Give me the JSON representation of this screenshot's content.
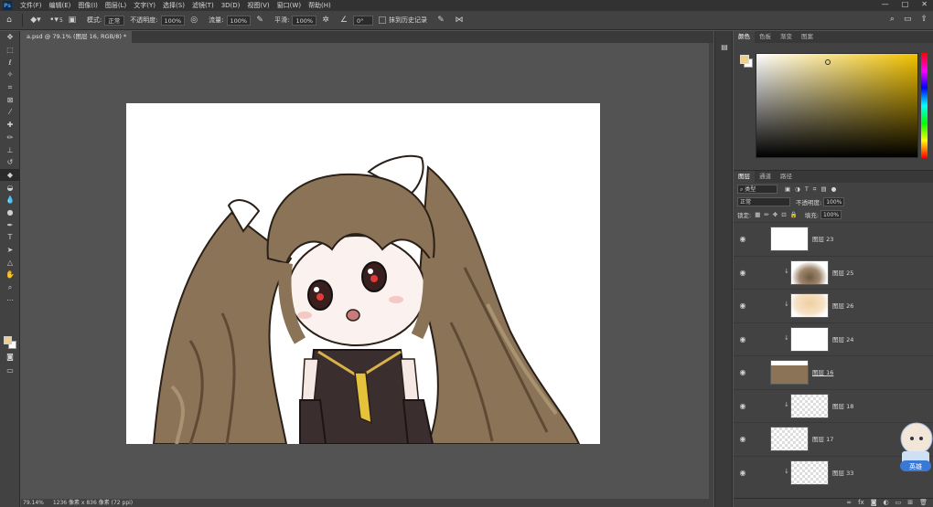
{
  "menubar": {
    "app_icon": "Ps",
    "items": [
      "文件(F)",
      "编辑(E)",
      "图像(I)",
      "图层(L)",
      "文字(Y)",
      "选择(S)",
      "滤镜(T)",
      "3D(D)",
      "视图(V)",
      "窗口(W)",
      "帮助(H)"
    ],
    "window_controls": [
      "—",
      "□",
      "✕"
    ]
  },
  "options": {
    "brush_size": "5",
    "mode_label": "模式:",
    "mode_value": "正常",
    "opacity_label": "不透明度:",
    "opacity_value": "100%",
    "flow_label": "流量:",
    "flow_value": "100%",
    "smooth_label": "平滑:",
    "smooth_value": "100%",
    "angle_value": "0°",
    "history_label": "抹到历史记录"
  },
  "document": {
    "tab_title": "a.psd @ 79.1% (图层 16, RGB/8) *",
    "status_zoom": "79.14%",
    "status_size": "1236 像素 x 836 像素 (72 ppi)"
  },
  "color_panel": {
    "tabs": [
      "颜色",
      "色板",
      "渐变",
      "图案"
    ],
    "foreground": "#f1cf86",
    "background": "#ffffff",
    "hue": "#f2c200"
  },
  "layers_panel": {
    "tabs": [
      "图层",
      "通道",
      "路径"
    ],
    "filter_label": "类型",
    "blend_mode": "正常",
    "opacity_label": "不透明度:",
    "opacity_value": "100%",
    "lock_label": "锁定:",
    "fill_label": "填充:",
    "fill_value": "100%",
    "layers": [
      {
        "name": "图层 23",
        "clipped": false,
        "thumb": "blank"
      },
      {
        "name": "图层 25",
        "clipped": true,
        "thumb": "brown-shadow"
      },
      {
        "name": "图层 26",
        "clipped": true,
        "thumb": "peach"
      },
      {
        "name": "图层 24",
        "clipped": true,
        "thumb": "sketch"
      },
      {
        "name": "图层 16",
        "clipped": false,
        "thumb": "hair"
      },
      {
        "name": "图层 18",
        "clipped": true,
        "thumb": "transparent"
      },
      {
        "name": "图层 17",
        "clipped": false,
        "thumb": "transparent"
      },
      {
        "name": "图层 33",
        "clipped": true,
        "thumb": "transparent"
      }
    ]
  },
  "mascot_label": "英雄"
}
